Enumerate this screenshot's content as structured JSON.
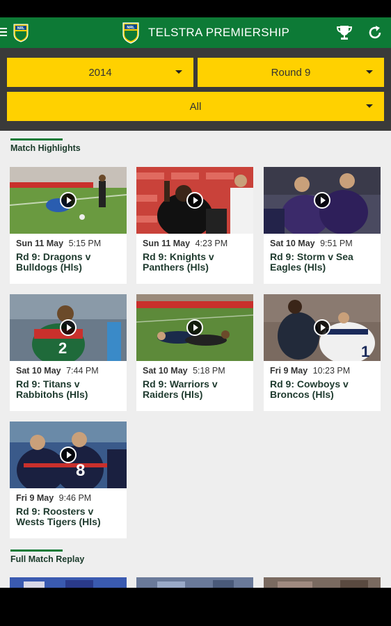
{
  "app": {
    "title": "TELSTRA PREMIERSHIP"
  },
  "icons": {
    "menu": "hamburger-menu-icon",
    "logo": "nrl-logo-icon",
    "trophy": "trophy-icon",
    "refresh": "refresh-icon"
  },
  "filters": {
    "season": "2014",
    "round": "Round 9",
    "team": "All"
  },
  "sections": {
    "highlights": "Match Highlights",
    "replay": "Full Match Replay"
  },
  "cards": [
    {
      "date": "Sun 11 May",
      "time": "5:15 PM",
      "title": "Rd 9: Dragons v Bulldogs (Hls)"
    },
    {
      "date": "Sun 11 May",
      "time": "4:23 PM",
      "title": "Rd 9: Knights v Panthers (Hls)"
    },
    {
      "date": "Sat 10 May",
      "time": "9:51 PM",
      "title": "Rd 9: Storm v Sea Eagles (Hls)"
    },
    {
      "date": "Sat 10 May",
      "time": "7:44 PM",
      "title": "Rd 9: Titans v Rabbitohs (Hls)"
    },
    {
      "date": "Sat 10 May",
      "time": "5:18 PM",
      "title": "Rd 9: Warriors v Raiders (Hls)"
    },
    {
      "date": "Fri 9 May",
      "time": "10:23 PM",
      "title": "Rd 9: Cowboys v Broncos (Hls)"
    },
    {
      "date": "Fri 9 May",
      "time": "9:46 PM",
      "title": "Rd 9: Roosters v Wests Tigers (Hls)"
    }
  ],
  "colors": {
    "brand_green": "#0d7a36",
    "dropdown_yellow": "#ffd100",
    "filter_bg": "#3a3a3a",
    "content_bg": "#eeeeee"
  }
}
